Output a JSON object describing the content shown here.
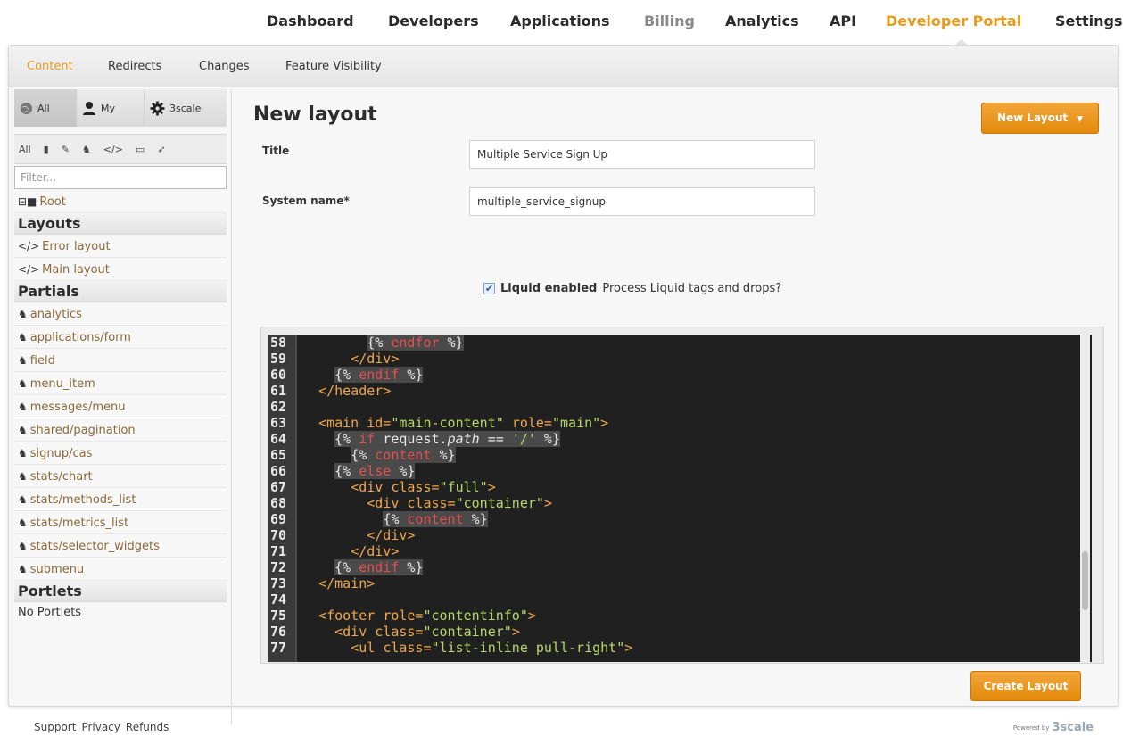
{
  "topnav": {
    "items": [
      "Dashboard",
      "Developers",
      "Applications",
      "Billing",
      "Analytics",
      "API",
      "Developer Portal",
      "Settings"
    ]
  },
  "subnav": {
    "items": [
      "Content",
      "Redirects",
      "Changes",
      "Feature Visibility"
    ]
  },
  "sidebar": {
    "scope": [
      "All",
      "My",
      "3scale"
    ],
    "types_label": "All",
    "filter_placeholder": "Filter...",
    "root_label": "Root",
    "layouts_heading": "Layouts",
    "layouts": [
      "Error layout",
      "Main layout"
    ],
    "partials_heading": "Partials",
    "partials": [
      "analytics",
      "applications/form",
      "field",
      "menu_item",
      "messages/menu",
      "shared/pagination",
      "signup/cas",
      "stats/chart",
      "stats/methods_list",
      "stats/metrics_list",
      "stats/selector_widgets",
      "submenu"
    ],
    "portlets_heading": "Portlets",
    "portlets_empty": "No Portlets"
  },
  "form": {
    "page_title": "New layout",
    "new_layout_button": "New Layout",
    "title_label": "Title",
    "title_value": "Multiple Service Sign Up",
    "system_name_label": "System name*",
    "system_name_value": "multiple_service_signup",
    "liquid_label": "Liquid enabled",
    "liquid_hint": "Process Liquid tags and drops?",
    "create_button": "Create Layout"
  },
  "editor": {
    "lines": [
      {
        "n": "58",
        "html": "        <span class='liq'>{% <span class='kw'>endfor</span> %}</span>"
      },
      {
        "n": "59",
        "html": "      <span class='tag'>&lt;/div&gt;</span>"
      },
      {
        "n": "60",
        "html": "    <span class='liq'>{% <span class='kw'>endif</span> %}</span>"
      },
      {
        "n": "61",
        "html": "  <span class='tag'>&lt;/header&gt;</span>"
      },
      {
        "n": "62",
        "html": ""
      },
      {
        "n": "63",
        "html": "  <span class='tag'>&lt;main</span> <span class='tag'>id=</span><span class='str'>\"main-content\"</span> <span class='tag'>role=</span><span class='str'>\"main\"</span><span class='tag'>&gt;</span>"
      },
      {
        "n": "64",
        "html": "    <span class='liq'>{% <span class='kw'>if</span> request.<i>path</i> == <span class='str'>'/'</span> %}</span>"
      },
      {
        "n": "65",
        "html": "      <span class='liq'>{% <span class='kw'>content</span> %}</span>"
      },
      {
        "n": "66",
        "html": "    <span class='liq'>{% <span class='kw'>else</span> %}</span>"
      },
      {
        "n": "67",
        "html": "      <span class='tag'>&lt;div</span> <span class='tag'>class=</span><span class='str'>\"full\"</span><span class='tag'>&gt;</span>"
      },
      {
        "n": "68",
        "html": "        <span class='tag'>&lt;div</span> <span class='tag'>class=</span><span class='str'>\"container\"</span><span class='tag'>&gt;</span>"
      },
      {
        "n": "69",
        "html": "          <span class='liq'>{% <span class='kw'>content</span> %}</span>"
      },
      {
        "n": "70",
        "html": "        <span class='tag'>&lt;/div&gt;</span>"
      },
      {
        "n": "71",
        "html": "      <span class='tag'>&lt;/div&gt;</span>"
      },
      {
        "n": "72",
        "html": "    <span class='liq'>{% <span class='kw'>endif</span> %}</span>"
      },
      {
        "n": "73",
        "html": "  <span class='tag'>&lt;/main&gt;</span>"
      },
      {
        "n": "74",
        "html": ""
      },
      {
        "n": "75",
        "html": "  <span class='tag'>&lt;footer</span> <span class='tag'>role=</span><span class='str'>\"contentinfo\"</span><span class='tag'>&gt;</span>"
      },
      {
        "n": "76",
        "html": "    <span class='tag'>&lt;div</span> <span class='tag'>class=</span><span class='str'>\"container\"</span><span class='tag'>&gt;</span>"
      },
      {
        "n": "77",
        "html": "      <span class='tag'>&lt;ul</span> <span class='tag'>class=</span><span class='str'>\"list-inline pull-right\"</span><span class='tag'>&gt;</span>"
      }
    ]
  },
  "footer": {
    "links": [
      "Support",
      "Privacy",
      "Refunds"
    ],
    "powered_prefix": "Powered by",
    "powered_brand": "3scale"
  },
  "colors": {
    "accent": "#e89a1a",
    "editor_bg": "#202020"
  }
}
